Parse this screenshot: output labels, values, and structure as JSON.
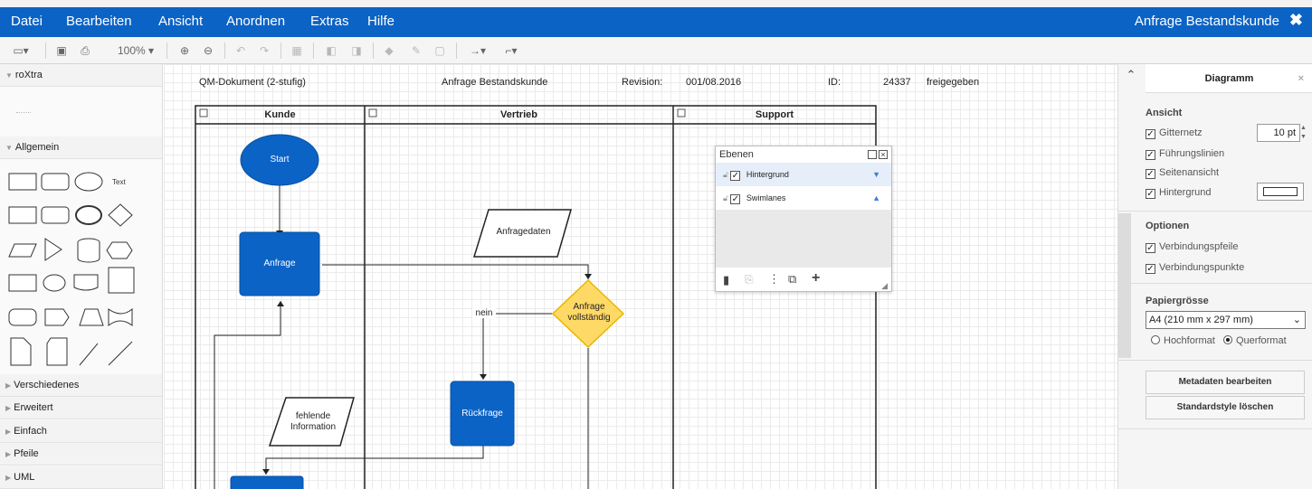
{
  "menubar": {
    "items": [
      "Datei",
      "Bearbeiten",
      "Ansicht",
      "Anordnen",
      "Extras",
      "Hilfe"
    ],
    "doc_title": "Anfrage Bestandskunde",
    "close_glyph": "✖"
  },
  "toolbar": {
    "zoom": "100%"
  },
  "sidebar": {
    "top_section": "roXtra",
    "general_section": "Allgemein",
    "text_shape_label": "Text",
    "sections": [
      "Verschiedenes",
      "Erweitert",
      "Einfach",
      "Pfeile",
      "UML"
    ]
  },
  "canvas": {
    "header": {
      "doc_type": "QM-Dokument (2-stufig)",
      "title": "Anfrage Bestandskunde",
      "revision_label": "Revision:",
      "revision_value": "001/08.2016",
      "id_label": "ID:",
      "id_value": "24337",
      "status": "freigegeben"
    },
    "lanes": [
      "Kunde",
      "Vertrieb",
      "Support"
    ],
    "nodes": {
      "start": "Start",
      "anfrage": "Anfrage",
      "anfragedaten": "Anfragedaten",
      "decision_line1": "Anfrage",
      "decision_line2": "vollständig",
      "nein": "nein",
      "rueckfrage": "Rückfrage",
      "fehlende_line1": "fehlende",
      "fehlende_line2": "Information"
    },
    "colors": {
      "node_fill": "#0b63c6",
      "decision_fill": "#ffd966",
      "decision_stroke": "#e6b800"
    }
  },
  "layers_panel": {
    "title": "Ebenen",
    "layers": [
      "Hintergrund",
      "Swimlanes"
    ]
  },
  "format_panel": {
    "title": "Diagramm",
    "view_section": "Ansicht",
    "grid_label": "Gitternetz",
    "grid_size": "10 pt",
    "guides_label": "Führungslinien",
    "page_view_label": "Seitenansicht",
    "background_label": "Hintergrund",
    "options_section": "Optionen",
    "connection_arrows_label": "Verbindungspfeile",
    "connection_points_label": "Verbindungspunkte",
    "paper_section": "Papiergrösse",
    "paper_size": "A4 (210 mm x 297 mm)",
    "portrait_label": "Hochformat",
    "landscape_label": "Querformat",
    "edit_metadata_button": "Metadaten bearbeiten",
    "clear_style_button": "Standardstyle löschen"
  }
}
